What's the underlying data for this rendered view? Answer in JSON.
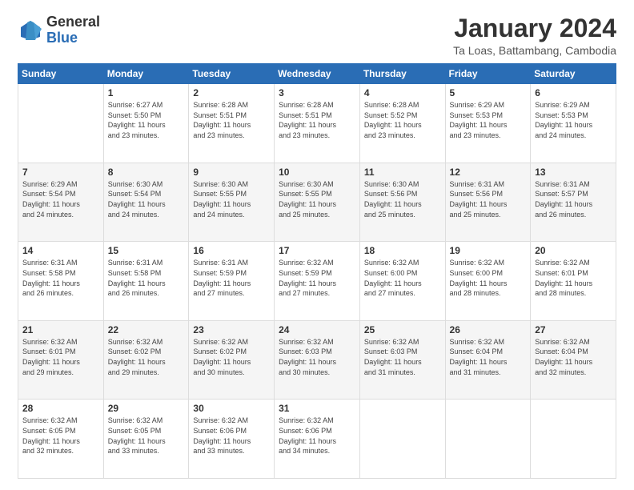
{
  "logo": {
    "general": "General",
    "blue": "Blue"
  },
  "title": "January 2024",
  "location": "Ta Loas, Battambang, Cambodia",
  "days_header": [
    "Sunday",
    "Monday",
    "Tuesday",
    "Wednesday",
    "Thursday",
    "Friday",
    "Saturday"
  ],
  "weeks": [
    [
      {
        "day": "",
        "info": ""
      },
      {
        "day": "1",
        "info": "Sunrise: 6:27 AM\nSunset: 5:50 PM\nDaylight: 11 hours\nand 23 minutes."
      },
      {
        "day": "2",
        "info": "Sunrise: 6:28 AM\nSunset: 5:51 PM\nDaylight: 11 hours\nand 23 minutes."
      },
      {
        "day": "3",
        "info": "Sunrise: 6:28 AM\nSunset: 5:51 PM\nDaylight: 11 hours\nand 23 minutes."
      },
      {
        "day": "4",
        "info": "Sunrise: 6:28 AM\nSunset: 5:52 PM\nDaylight: 11 hours\nand 23 minutes."
      },
      {
        "day": "5",
        "info": "Sunrise: 6:29 AM\nSunset: 5:53 PM\nDaylight: 11 hours\nand 23 minutes."
      },
      {
        "day": "6",
        "info": "Sunrise: 6:29 AM\nSunset: 5:53 PM\nDaylight: 11 hours\nand 24 minutes."
      }
    ],
    [
      {
        "day": "7",
        "info": "Sunrise: 6:29 AM\nSunset: 5:54 PM\nDaylight: 11 hours\nand 24 minutes."
      },
      {
        "day": "8",
        "info": "Sunrise: 6:30 AM\nSunset: 5:54 PM\nDaylight: 11 hours\nand 24 minutes."
      },
      {
        "day": "9",
        "info": "Sunrise: 6:30 AM\nSunset: 5:55 PM\nDaylight: 11 hours\nand 24 minutes."
      },
      {
        "day": "10",
        "info": "Sunrise: 6:30 AM\nSunset: 5:55 PM\nDaylight: 11 hours\nand 25 minutes."
      },
      {
        "day": "11",
        "info": "Sunrise: 6:30 AM\nSunset: 5:56 PM\nDaylight: 11 hours\nand 25 minutes."
      },
      {
        "day": "12",
        "info": "Sunrise: 6:31 AM\nSunset: 5:56 PM\nDaylight: 11 hours\nand 25 minutes."
      },
      {
        "day": "13",
        "info": "Sunrise: 6:31 AM\nSunset: 5:57 PM\nDaylight: 11 hours\nand 26 minutes."
      }
    ],
    [
      {
        "day": "14",
        "info": "Sunrise: 6:31 AM\nSunset: 5:58 PM\nDaylight: 11 hours\nand 26 minutes."
      },
      {
        "day": "15",
        "info": "Sunrise: 6:31 AM\nSunset: 5:58 PM\nDaylight: 11 hours\nand 26 minutes."
      },
      {
        "day": "16",
        "info": "Sunrise: 6:31 AM\nSunset: 5:59 PM\nDaylight: 11 hours\nand 27 minutes."
      },
      {
        "day": "17",
        "info": "Sunrise: 6:32 AM\nSunset: 5:59 PM\nDaylight: 11 hours\nand 27 minutes."
      },
      {
        "day": "18",
        "info": "Sunrise: 6:32 AM\nSunset: 6:00 PM\nDaylight: 11 hours\nand 27 minutes."
      },
      {
        "day": "19",
        "info": "Sunrise: 6:32 AM\nSunset: 6:00 PM\nDaylight: 11 hours\nand 28 minutes."
      },
      {
        "day": "20",
        "info": "Sunrise: 6:32 AM\nSunset: 6:01 PM\nDaylight: 11 hours\nand 28 minutes."
      }
    ],
    [
      {
        "day": "21",
        "info": "Sunrise: 6:32 AM\nSunset: 6:01 PM\nDaylight: 11 hours\nand 29 minutes."
      },
      {
        "day": "22",
        "info": "Sunrise: 6:32 AM\nSunset: 6:02 PM\nDaylight: 11 hours\nand 29 minutes."
      },
      {
        "day": "23",
        "info": "Sunrise: 6:32 AM\nSunset: 6:02 PM\nDaylight: 11 hours\nand 30 minutes."
      },
      {
        "day": "24",
        "info": "Sunrise: 6:32 AM\nSunset: 6:03 PM\nDaylight: 11 hours\nand 30 minutes."
      },
      {
        "day": "25",
        "info": "Sunrise: 6:32 AM\nSunset: 6:03 PM\nDaylight: 11 hours\nand 31 minutes."
      },
      {
        "day": "26",
        "info": "Sunrise: 6:32 AM\nSunset: 6:04 PM\nDaylight: 11 hours\nand 31 minutes."
      },
      {
        "day": "27",
        "info": "Sunrise: 6:32 AM\nSunset: 6:04 PM\nDaylight: 11 hours\nand 32 minutes."
      }
    ],
    [
      {
        "day": "28",
        "info": "Sunrise: 6:32 AM\nSunset: 6:05 PM\nDaylight: 11 hours\nand 32 minutes."
      },
      {
        "day": "29",
        "info": "Sunrise: 6:32 AM\nSunset: 6:05 PM\nDaylight: 11 hours\nand 33 minutes."
      },
      {
        "day": "30",
        "info": "Sunrise: 6:32 AM\nSunset: 6:06 PM\nDaylight: 11 hours\nand 33 minutes."
      },
      {
        "day": "31",
        "info": "Sunrise: 6:32 AM\nSunset: 6:06 PM\nDaylight: 11 hours\nand 34 minutes."
      },
      {
        "day": "",
        "info": ""
      },
      {
        "day": "",
        "info": ""
      },
      {
        "day": "",
        "info": ""
      }
    ]
  ]
}
